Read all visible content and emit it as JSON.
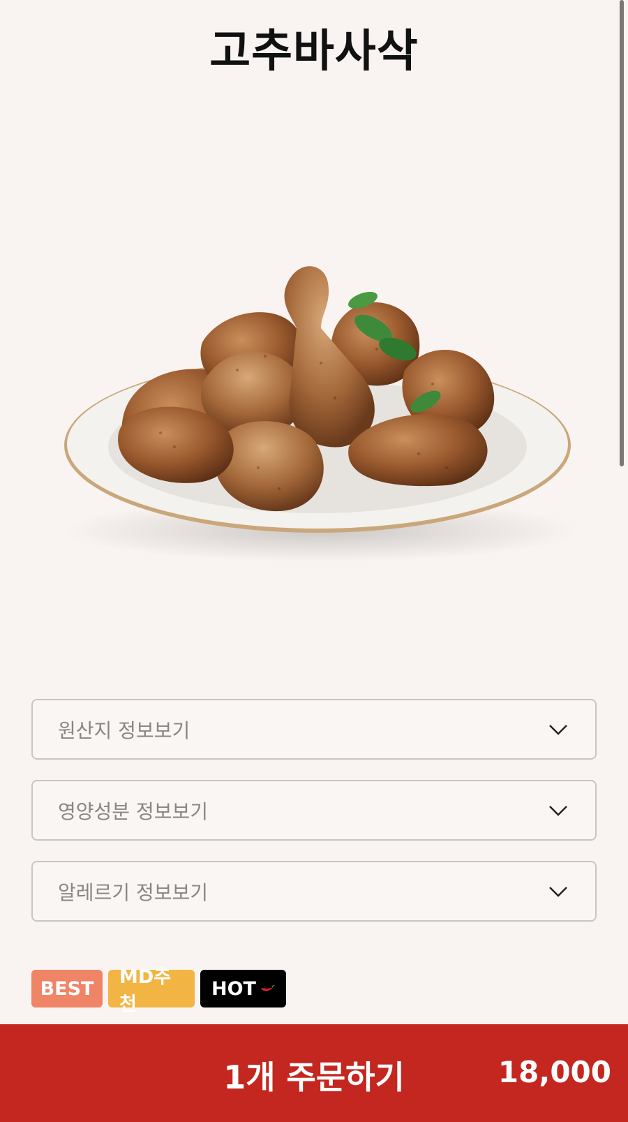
{
  "product": {
    "title": "고추바사삭"
  },
  "accordions": [
    {
      "label": "원산지 정보보기"
    },
    {
      "label": "영양성분 정보보기"
    },
    {
      "label": "알레르기 정보보기"
    }
  ],
  "badges": {
    "best": "BEST",
    "md": "MD추천",
    "hot": "HOT"
  },
  "order": {
    "label": "1개 주문하기",
    "price": "18,000"
  },
  "colors": {
    "background": "#f9f4f1",
    "order_bar": "#c3271f",
    "badge_best": "#f08467",
    "badge_md": "#f2b543",
    "badge_hot": "#000000"
  },
  "icons": [
    "chevron-down-icon",
    "chili-pepper-icon"
  ]
}
